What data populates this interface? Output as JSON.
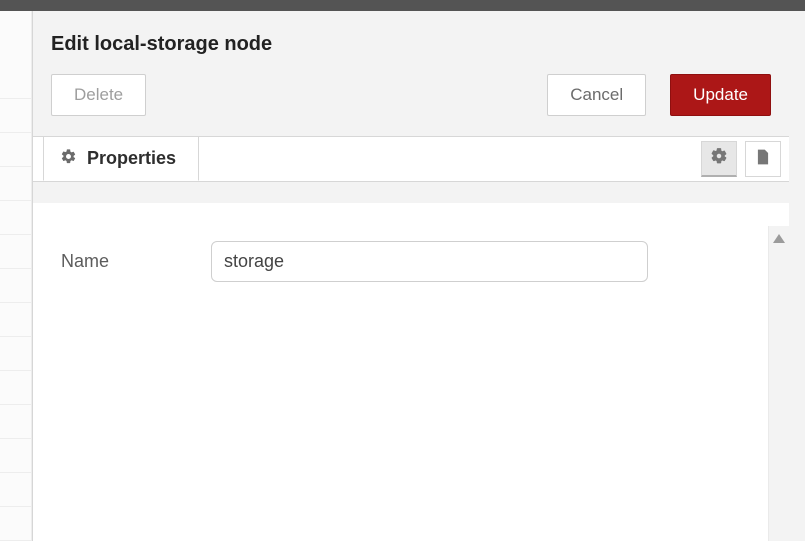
{
  "dialog": {
    "title": "Edit local-storage node",
    "buttons": {
      "delete": "Delete",
      "cancel": "Cancel",
      "update": "Update"
    }
  },
  "tabs": {
    "properties_label": "Properties"
  },
  "form": {
    "name_label": "Name",
    "name_value": "storage"
  },
  "colors": {
    "primary": "#ac1717"
  }
}
